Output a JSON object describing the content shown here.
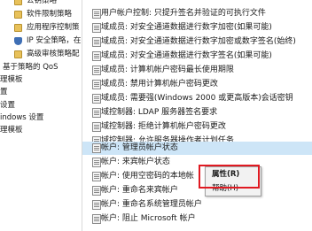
{
  "tree": {
    "items": [
      {
        "label": "公钥策略",
        "icon": "folder-icon"
      },
      {
        "label": "软件限制策略",
        "icon": "folder-icon"
      },
      {
        "label": "应用程序控制策",
        "icon": "folder-icon"
      },
      {
        "label": "IP 安全策略，在",
        "icon": "shield-icon"
      },
      {
        "label": "高级审核策略配",
        "icon": "folder-icon"
      },
      {
        "label": "基于策略的 QoS",
        "icon": ""
      },
      {
        "label": "理模板",
        "icon": ""
      },
      {
        "label": "置",
        "icon": ""
      },
      {
        "label": "设置",
        "icon": ""
      },
      {
        "label": "indows 设置",
        "icon": ""
      },
      {
        "label": "理模板",
        "icon": ""
      }
    ]
  },
  "policies": {
    "items": [
      {
        "label": "用户帐户控制: 只提升签名并验证的可执行文件"
      },
      {
        "label": "域成员: 对安全通道数据进行数字加密(如果可能)"
      },
      {
        "label": "域成员: 对安全通道数据进行数字加密或数字签名(始终)"
      },
      {
        "label": "域成员: 对安全通道数据进行数字签名(如果可能)"
      },
      {
        "label": "域成员: 计算机帐户密码最长使用期限"
      },
      {
        "label": "域成员: 禁用计算机帐户密码更改"
      },
      {
        "label": "域成员: 需要强(Windows 2000 或更高版本)会话密钥"
      },
      {
        "label": "域控制器: LDAP 服务器签名要求"
      },
      {
        "label": "域控制器: 拒绝计算机帐户密码更改"
      },
      {
        "label": "域控制器: 允许服务器操作者计划任务"
      },
      {
        "label": "帐户: 管理员帐户状态"
      },
      {
        "label": "帐户: 来宾帐户状态"
      },
      {
        "label": "帐户: 使用空密码的本地帐"
      },
      {
        "label": "帐户: 重命名来宾帐户"
      },
      {
        "label": "帐户: 重命名系统管理员帐户"
      },
      {
        "label": "帐户: 阻止 Microsoft 帐户"
      }
    ]
  },
  "context_menu": {
    "properties_label": "属性(R)",
    "help_label": "帮助(H)"
  },
  "colors": {
    "selection": "#cde5f7",
    "highlight_border": "#e01a22"
  }
}
